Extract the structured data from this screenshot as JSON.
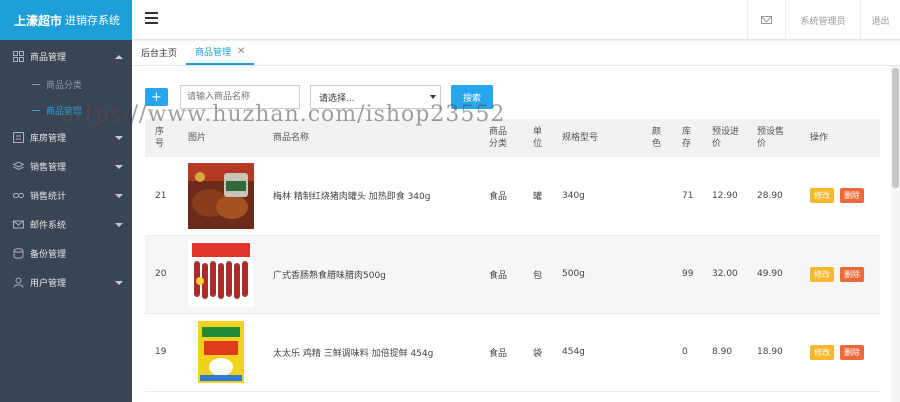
{
  "brand": {
    "name": "上濠超市",
    "subtitle": "进销存系统"
  },
  "topbar": {
    "admin_label": "系统管理员",
    "logout_label": "退出",
    "mail_icon": "mail-icon"
  },
  "tabs": [
    {
      "label": "后台主页"
    },
    {
      "label": "商品管理",
      "active": true
    }
  ],
  "sidebar": {
    "items": [
      {
        "label": "商品管理",
        "icon": "grid-icon",
        "expanded": true,
        "children": [
          {
            "label": "商品分类"
          },
          {
            "label": "商品管理",
            "active": true
          }
        ]
      },
      {
        "label": "库房管理",
        "icon": "list-icon"
      },
      {
        "label": "销售管理",
        "icon": "layers-icon"
      },
      {
        "label": "销售统计",
        "icon": "link-icon"
      },
      {
        "label": "邮件系统",
        "icon": "mail-icon"
      },
      {
        "label": "备份管理",
        "icon": "database-icon"
      },
      {
        "label": "用户管理",
        "icon": "user-icon"
      }
    ]
  },
  "toolbar": {
    "add_label": "+",
    "search_placeholder": "请输入商品名称",
    "select_value": "请选择...",
    "search_button": "搜索"
  },
  "table": {
    "headers": [
      "序\n号",
      "图片",
      "商品名称",
      "商品\n分类",
      "单\n位",
      "规格型号",
      "颜\n色",
      "库\n存",
      "预设进\n价",
      "预设售\n价",
      "操作"
    ],
    "rows": [
      {
        "id": "21",
        "name": "梅林 精制红烧猪肉罐头 加热即食 340g",
        "category": "食品",
        "unit": "罐",
        "spec": "340g",
        "color": "",
        "stock": "71",
        "cost": "12.90",
        "price": "28.90"
      },
      {
        "id": "20",
        "name": "广式香肠熟食腊味腊肉500g",
        "category": "食品",
        "unit": "包",
        "spec": "500g",
        "color": "",
        "stock": "99",
        "cost": "32.00",
        "price": "49.90"
      },
      {
        "id": "19",
        "name": "太太乐 鸡精 三鲜调味料 加倍提鲜 454g",
        "category": "食品",
        "unit": "袋",
        "spec": "454g",
        "color": "",
        "stock": "0",
        "cost": "8.90",
        "price": "18.90"
      }
    ],
    "edit_label": "修改",
    "delete_label": "删除"
  },
  "watermark": "https://www.huzhan.com/ishop23552",
  "colors": {
    "brand": "#1e9fd8",
    "sidebar": "#3a4452",
    "accent": "#26a6ed",
    "edit": "#f5b82e",
    "delete": "#ec6a3a"
  }
}
